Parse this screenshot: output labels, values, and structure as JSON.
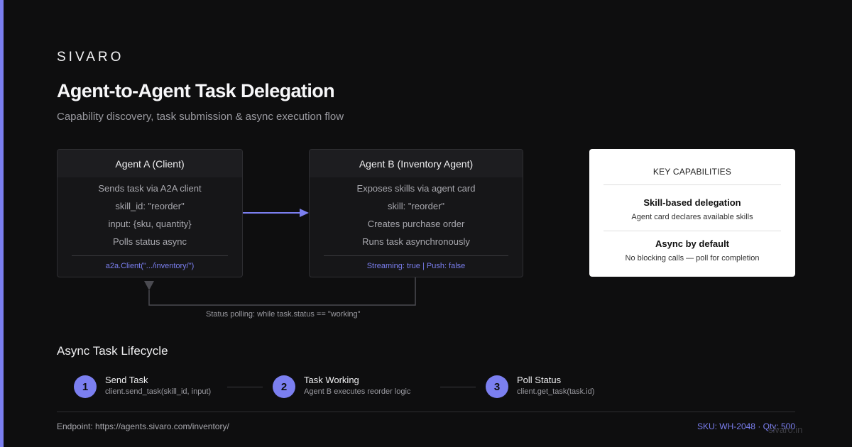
{
  "brand": "SIVARO",
  "title": "Agent-to-Agent Task Delegation",
  "subtitle": "Capability discovery, task submission & async execution flow",
  "agent_a": {
    "header": "Agent A (Client)",
    "lines": [
      "Sends task via A2A client",
      "skill_id: \"reorder\"",
      "input: {sku, quantity}",
      "Polls status async"
    ],
    "footer": "a2a.Client(\".../inventory/\")"
  },
  "agent_b": {
    "header": "Agent B (Inventory Agent)",
    "lines": [
      "Exposes skills via agent card",
      "skill: \"reorder\"",
      "Creates purchase order",
      "Runs task asynchronously"
    ],
    "footer": "Streaming: true | Push: false"
  },
  "capabilities": {
    "heading": "KEY CAPABILITIES",
    "items": [
      {
        "title": "Skill-based delegation",
        "desc": "Agent card declares available skills"
      },
      {
        "title": "Async by default",
        "desc": "No blocking calls — poll for completion"
      }
    ]
  },
  "polling_label": "Status polling: while task.status == \"working\"",
  "lifecycle": {
    "title": "Async Task Lifecycle",
    "steps": [
      {
        "num": "1",
        "title": "Send Task",
        "desc": "client.send_task(skill_id, input)"
      },
      {
        "num": "2",
        "title": "Task Working",
        "desc": "Agent B executes reorder logic"
      },
      {
        "num": "3",
        "title": "Poll Status",
        "desc": "client.get_task(task.id)"
      }
    ]
  },
  "footer": {
    "endpoint": "Endpoint: https://agents.sivaro.com/inventory/",
    "sku": "SKU: WH-2048 · Qty: 500",
    "watermark": "sivaro.in"
  },
  "colors": {
    "accent": "#7b7ff0",
    "background": "#0e0e0f",
    "card": "#161618",
    "capabilities_card": "#ffffff"
  }
}
